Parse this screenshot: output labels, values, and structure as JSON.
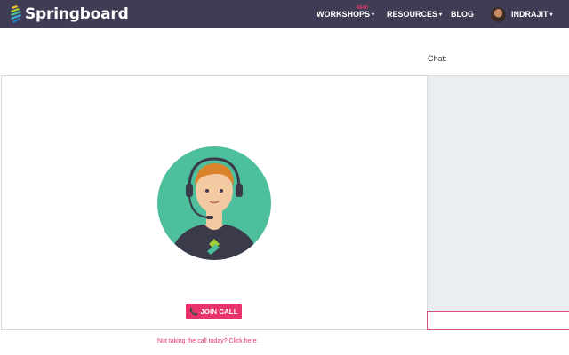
{
  "header": {
    "brand": "Springboard",
    "nav": {
      "workshops": "WORKSHOPS",
      "workshops_badge": "NEW!",
      "resources": "RESOURCES",
      "blog": "BLOG",
      "user": "INDRAJIT"
    },
    "caret": "▾"
  },
  "chat": {
    "label": "Chat:",
    "input_value": ""
  },
  "call": {
    "join_label": "JOIN CALL",
    "skip_link": "Not taking the call today? Click here."
  },
  "icons": [
    "springboard-logo-icon",
    "caret-down-icon",
    "user-avatar",
    "support-agent-avatar",
    "phone-icon"
  ],
  "colors": {
    "topbar": "#3f3d55",
    "accent": "#e8336b",
    "avatar_circle": "#4dbf9c",
    "chat_bg": "#ebeef0"
  }
}
